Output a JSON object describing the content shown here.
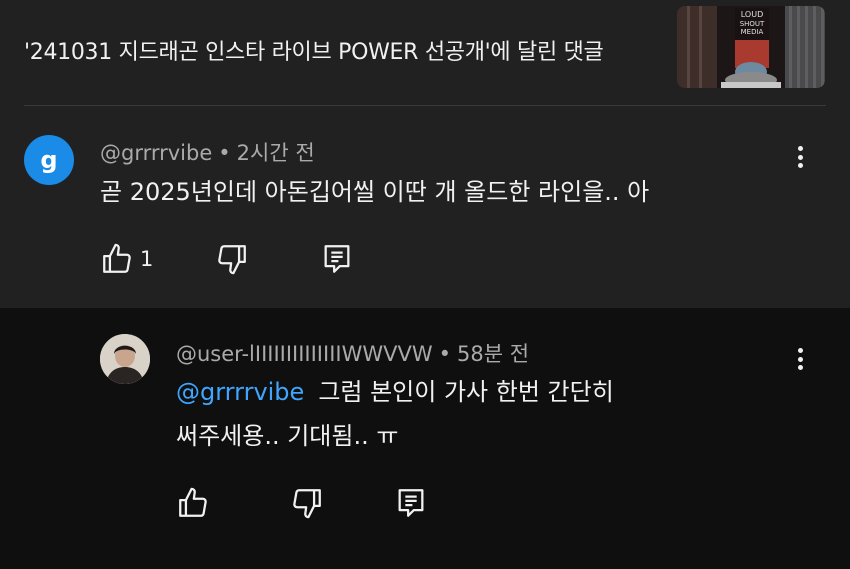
{
  "header": {
    "video_title": "'241031 지드래곤 인스타 라이브 POWER 선공개'에 달린 댓글",
    "thumbnail_text": [
      "LOUD",
      "SHOUT",
      "MEDIA"
    ]
  },
  "comment": {
    "avatar_letter": "g",
    "handle": "@grrrrvibe",
    "separator": "•",
    "time": "2시간 전",
    "text": "곧 2025년인데 아돈깁어씰 이딴 개 올드한 라인을.. 아",
    "like_count": "1"
  },
  "reply": {
    "handle": "@user-lIIIIIIIIIIIIIIWWVVW",
    "separator": "•",
    "time": "58분 전",
    "mention": "@grrrrvibe",
    "text_line1": "그럼 본인이 가사 한번 간단히",
    "text_line2": "써주세용.. 기대됨.. ㅠ"
  },
  "colors": {
    "top_background": "#212121",
    "reply_background": "#0f0f0f",
    "avatar_blue": "#1a8be6",
    "mention_blue": "#3ea6ff",
    "meta_gray": "#aaaaaa"
  },
  "icons": [
    "thumbs-up-icon",
    "thumbs-down-icon",
    "reply-icon",
    "more-vert-icon"
  ]
}
